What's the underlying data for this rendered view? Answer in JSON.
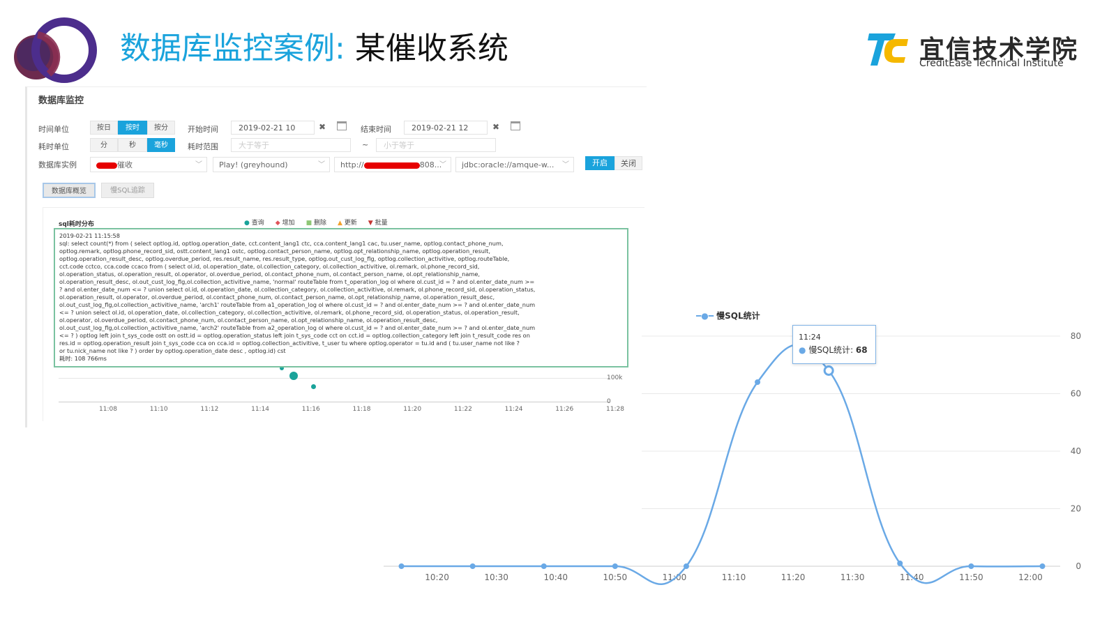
{
  "slide": {
    "title_part1": "数据库监控案例:",
    "title_part2": "某催收系统",
    "brand_cn": "宜信技术学院",
    "brand_en": "CreditEase Technical Institute",
    "logo_text": "TC"
  },
  "panel": {
    "title": "数据库监控",
    "time_unit": {
      "label": "时间单位",
      "options": [
        "按日",
        "按时",
        "按分"
      ],
      "selected": "按时"
    },
    "start_time": {
      "label": "开始时间",
      "value": "2019-02-21 10"
    },
    "end_time": {
      "label": "结束时间",
      "value": "2019-02-21 12"
    },
    "cost_unit": {
      "label": "耗时单位",
      "options": [
        "分",
        "秒",
        "毫秒"
      ],
      "selected": "毫秒"
    },
    "cost_range": {
      "label": "耗时范围",
      "min_placeholder": "大于等于",
      "sep": "~",
      "max_placeholder": "小于等于"
    },
    "instance": {
      "label": "数据库实例",
      "sel1": "催收",
      "sel2": "Play! (greyhound)",
      "sel3": "http://",
      "sel3_suffix": "808...",
      "sel4": "jdbc:oracle://amque-w..."
    },
    "btn_open": "开启",
    "btn_close": "关闭",
    "tabs": [
      "数据库概览",
      "慢SQL追踪"
    ],
    "clear_icon": "close-icon",
    "calendar_icon": "calendar-icon",
    "inner_chart": {
      "title": "sql耗时分布",
      "legend": [
        {
          "name": "查询",
          "shape": "circle",
          "color": "#1aa39a"
        },
        {
          "name": "增加",
          "shape": "diamond",
          "color": "#e0545a"
        },
        {
          "name": "删除",
          "shape": "square",
          "color": "#8fc776"
        },
        {
          "name": "更新",
          "shape": "triangle",
          "color": "#f2a12c"
        },
        {
          "name": "批量",
          "shape": "triangle-down",
          "color": "#c23531"
        }
      ],
      "x_ticks": [
        "11:08",
        "11:10",
        "11:12",
        "11:14",
        "11:16",
        "11:18",
        "11:20",
        "11:22",
        "11:24",
        "11:26",
        "11:28"
      ],
      "y_ticks": [
        "100k",
        "0"
      ],
      "tooltip_lines": [
        "2019-02-21 11:15:58",
        "sql:  select count(*) from ( select optlog.id, optlog.operation_date, cct.content_lang1 ctc, cca.content_lang1 cac, tu.user_name, optlog.contact_phone_num,",
        "optlog.remark, optlog.phone_record_sid, ostt.content_lang1 ostc, optlog.contact_person_name, optlog.opt_relationship_name, optlog.operation_result,",
        "optlog.operation_result_desc, optlog.overdue_period, res.result_name, res.result_type, optlog.out_cust_log_flg, optlog.collection_activitive, optlog.routeTable,",
        "cct.code cctco, cca.code ccaco from ( select ol.id, ol.operation_date, ol.collection_category, ol.collection_activitive, ol.remark, ol.phone_record_sid,",
        "ol.operation_status, ol.operation_result, ol.operator, ol.overdue_period, ol.contact_phone_num, ol.contact_person_name, ol.opt_relationship_name,",
        "ol.operation_result_desc, ol.out_cust_log_flg,ol.collection_activitive_name, 'normal' routeTable from t_operation_log ol where ol.cust_id = ? and ol.enter_date_num >=",
        "? and ol.enter_date_num <= ? union select ol.id, ol.operation_date, ol.collection_category, ol.collection_activitive, ol.remark, ol.phone_record_sid, ol.operation_status,",
        "ol.operation_result, ol.operator, ol.overdue_period, ol.contact_phone_num, ol.contact_person_name, ol.opt_relationship_name, ol.operation_result_desc,",
        "ol.out_cust_log_flg,ol.collection_activitive_name, 'arch1' routeTable from a1_operation_log ol where ol.cust_id = ? and ol.enter_date_num >= ? and ol.enter_date_num",
        "<= ? union select ol.id, ol.operation_date, ol.collection_category, ol.collection_activitive, ol.remark, ol.phone_record_sid, ol.operation_status, ol.operation_result,",
        "ol.operator, ol.overdue_period, ol.contact_phone_num, ol.contact_person_name, ol.opt_relationship_name, ol.operation_result_desc,",
        "ol.out_cust_log_flg,ol.collection_activitive_name, 'arch2' routeTable from a2_operation_log ol where ol.cust_id = ? and ol.enter_date_num >= ? and ol.enter_date_num",
        "<= ? ) optlog left join t_sys_code ostt on ostt.id = optlog.operation_status left join t_sys_code cct on cct.id = optlog.collection_category left join t_result_code res on",
        "res.id = optlog.operation_result join t_sys_code cca on cca.id = optlog.collection_activitive, t_user tu where optlog.operator = tu.id and ( tu.user_name not like ?",
        "or tu.nick_name not like ? ) order by optlog.operation_date desc , optlog.id) cst",
        "耗时:  108 766ms"
      ]
    }
  },
  "chart_data": {
    "type": "line",
    "title": "",
    "xlabel": "",
    "ylabel": "",
    "series": [
      {
        "name": "慢SQL统计",
        "color": "#6aa9e6",
        "x": [
          "10:14",
          "10:26",
          "10:38",
          "10:50",
          "11:02",
          "11:14",
          "11:26",
          "11:38",
          "11:50",
          "12:02"
        ],
        "values": [
          0,
          0,
          0,
          0,
          0,
          64,
          68,
          1,
          0,
          0
        ]
      }
    ],
    "x_ticks": [
      "10:20",
      "10:30",
      "10:40",
      "10:50",
      "11:00",
      "11:10",
      "11:20",
      "11:30",
      "11:40",
      "11:50",
      "12:00"
    ],
    "ylim": [
      0,
      80
    ],
    "y_ticks": [
      0,
      20,
      40,
      60,
      80
    ],
    "grid": true,
    "legend_position": "top-left",
    "tooltip": {
      "time": "11:24",
      "series": "慢SQL统计",
      "value": 68
    }
  }
}
